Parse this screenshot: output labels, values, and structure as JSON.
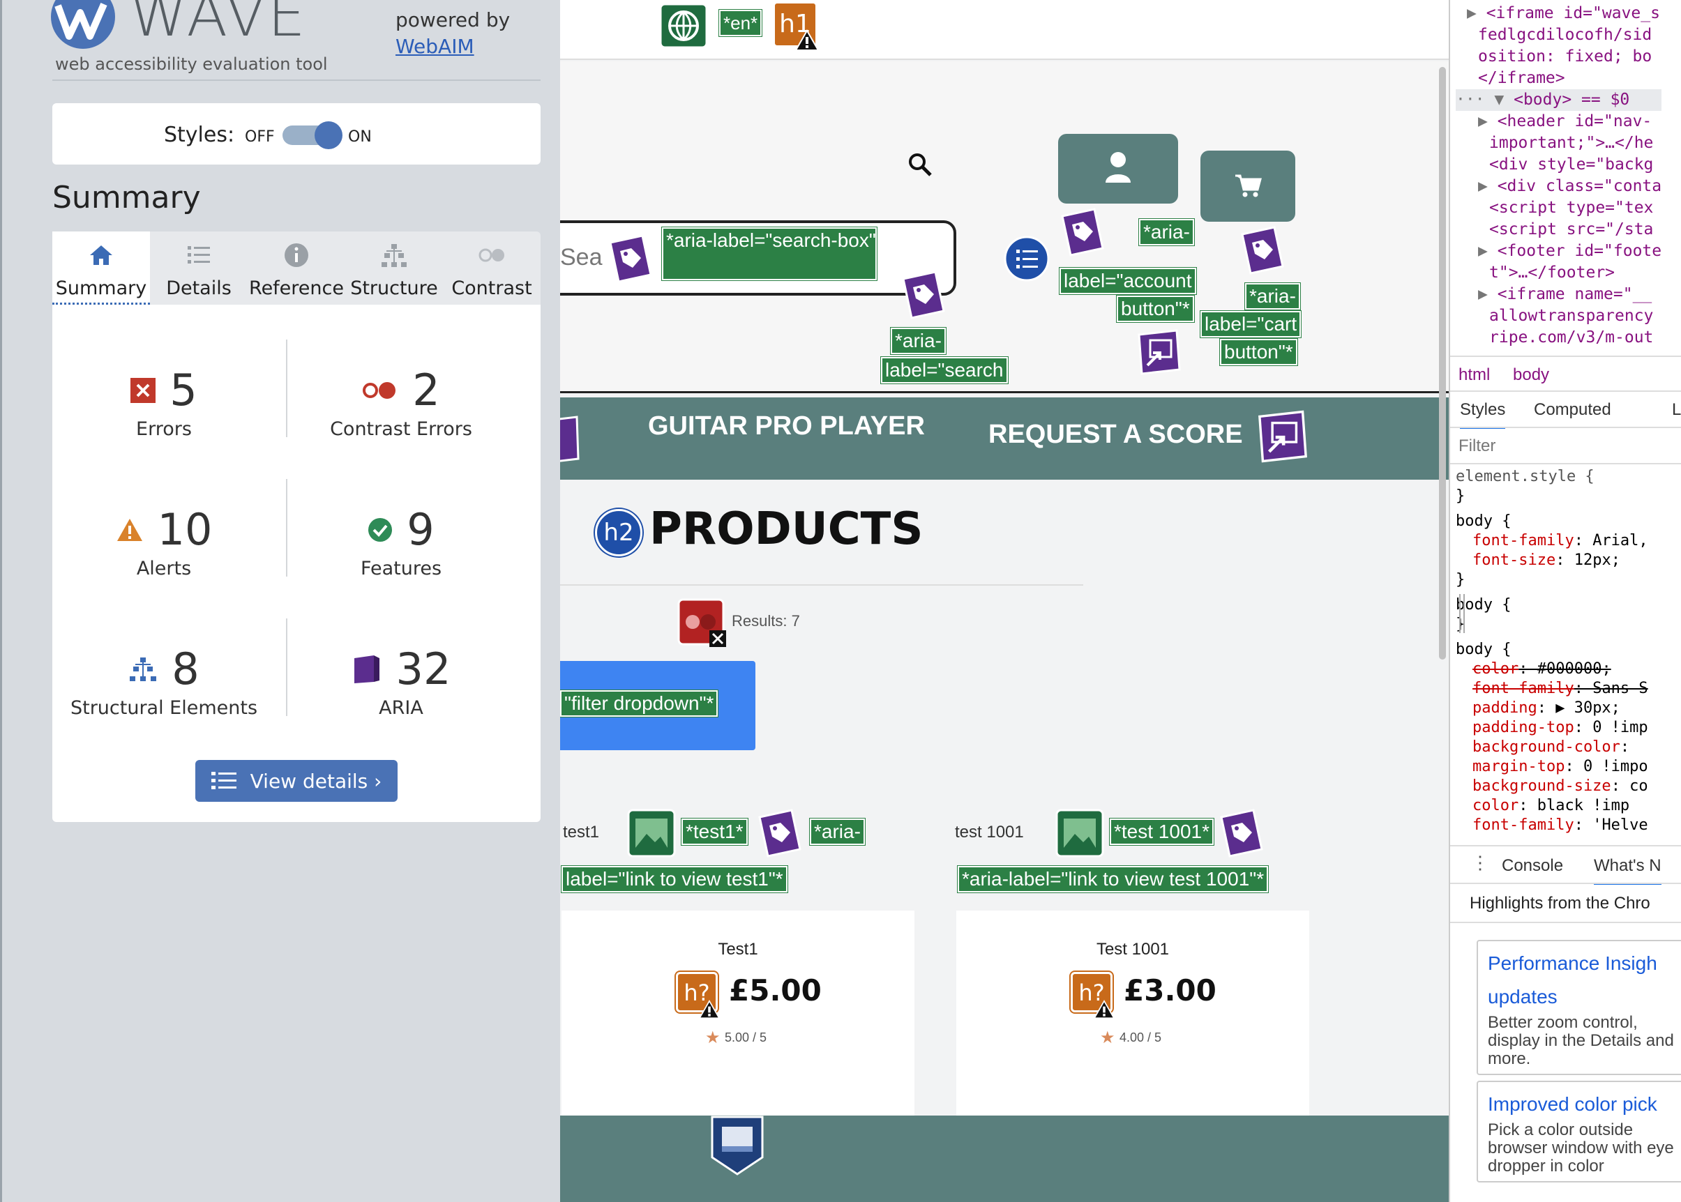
{
  "wave": {
    "logo_word": "WAVE",
    "tagline": "web accessibility evaluation tool",
    "powered_by": "powered by",
    "webaim_link": "WebAIM",
    "styles_label": "Styles:",
    "styles_off": "OFF",
    "styles_on": "ON",
    "summary_title": "Summary",
    "tabs": [
      {
        "label": "Summary",
        "icon": "home-icon",
        "active": true
      },
      {
        "label": "Details",
        "icon": "list-icon"
      },
      {
        "label": "Reference",
        "icon": "info-icon"
      },
      {
        "label": "Structure",
        "icon": "structure-icon"
      },
      {
        "label": "Contrast",
        "icon": "contrast-icon"
      }
    ],
    "stats": [
      {
        "num": "5",
        "label": "Errors",
        "icon": "error-icon"
      },
      {
        "num": "2",
        "label": "Contrast Errors",
        "icon": "contrast-error-icon"
      },
      {
        "num": "10",
        "label": "Alerts",
        "icon": "alert-icon"
      },
      {
        "num": "9",
        "label": "Features",
        "icon": "feature-icon"
      },
      {
        "num": "8",
        "label": "Structural Elements",
        "icon": "structure-icon"
      },
      {
        "num": "32",
        "label": "ARIA",
        "icon": "aria-icon"
      }
    ],
    "view_details": "View details ›",
    "colors": {
      "accent": "#4a72b5",
      "error": "#c0392b",
      "alert": "#d9822b",
      "feature": "#2e8b57",
      "aria": "#5b2d8e"
    }
  },
  "page": {
    "lang_badge": "*en*",
    "h1_badge": "h1",
    "search_placeholder": "Sea",
    "search_aria": "*aria-label=\"search-box\"*",
    "search_btn_aria_1": "*aria-",
    "search_btn_aria_2": "label=\"search",
    "account_aria_1": "*aria-",
    "account_aria_2": "label=\"account",
    "account_aria_3": "button\"*",
    "cart_aria_1": "*aria-",
    "cart_aria_2": "label=\"cart",
    "cart_aria_3": "button\"*",
    "nav_guitar": "GUITAR PRO PLAYER",
    "nav_request": "REQUEST A SCORE",
    "h2_badge": "h2",
    "products_title": "PRODUCTS",
    "results": "Results: 7",
    "filter_aria": "\"filter dropdown\"*",
    "cards": [
      {
        "img_alt": "test1",
        "alt_badge": "*test1*",
        "aria_1": "*aria-",
        "aria_2": "label=\"link to view test1\"*",
        "title": "Test1",
        "heading_badge": "h?",
        "price": "£5.00",
        "rating": "5.00 / 5"
      },
      {
        "img_alt": "test 1001",
        "alt_badge": "*test 1001*",
        "aria_2": "*aria-label=\"link to view test 1001\"*",
        "title": "Test 1001",
        "heading_badge": "h?",
        "price": "£3.00",
        "rating": "4.00 / 5"
      }
    ],
    "colors": {
      "nav": "#5a7f7d",
      "badge_green": "#2c8045",
      "filter": "#3e84f2"
    }
  },
  "devtools": {
    "dom_lines": [
      {
        "indent": 1,
        "arrow": "▶",
        "html": "<iframe id=\"wave_s"
      },
      {
        "indent": 2,
        "html": "fedlgcdilocofh/sid"
      },
      {
        "indent": 2,
        "html": "osition: fixed; bo"
      },
      {
        "indent": 2,
        "html": "</iframe>"
      },
      {
        "indent": 0,
        "arrow": "··· ▼",
        "html": "<body> == $0"
      },
      {
        "indent": 2,
        "arrow": "▶",
        "html": "<header id=\"nav-"
      },
      {
        "indent": 3,
        "html": "important;\">…</he"
      },
      {
        "indent": 3,
        "html": "<div style=\"backg"
      },
      {
        "indent": 2,
        "arrow": "▶",
        "html": "<div class=\"conta"
      },
      {
        "indent": 3,
        "html": "<script type=\"tex"
      },
      {
        "indent": 3,
        "html": "<script src=\"/sta"
      },
      {
        "indent": 2,
        "arrow": "▶",
        "html": "<footer id=\"foote"
      },
      {
        "indent": 3,
        "html": "t\">…</footer>"
      },
      {
        "indent": 2,
        "arrow": "▶",
        "html": "<iframe name=\"__"
      },
      {
        "indent": 3,
        "html": "allowtransparency"
      },
      {
        "indent": 3,
        "html": "ripe.com/v3/m-out"
      }
    ],
    "breadcrumbs": [
      "html",
      "body"
    ],
    "panel_tabs": [
      "Styles",
      "Computed",
      "L"
    ],
    "filter_placeholder": "Filter",
    "rules": [
      "element.style {",
      "}",
      "body {",
      "font-family: Arial,",
      "font-size: 12px;",
      "}",
      "body {",
      "}",
      "body {",
      "color: #000000;",
      "font-family: Sans S",
      "padding: ▶ 30px;",
      "padding-top: 0 !imp",
      "background-color: ",
      "margin-top: 0 !impo",
      "background-size: co",
      "color: black !imp",
      "font-family: 'Helve"
    ],
    "drawer_tabs": [
      "Console",
      "What's N"
    ],
    "highlights_title": "Highlights from the Chro",
    "cards": [
      {
        "title": "Performance Insigh",
        "title2": "updates",
        "desc": "Better zoom control, display in the Details and more."
      },
      {
        "title": "Improved color pick",
        "desc": "Pick a color outside browser window with eye dropper in color"
      }
    ]
  }
}
